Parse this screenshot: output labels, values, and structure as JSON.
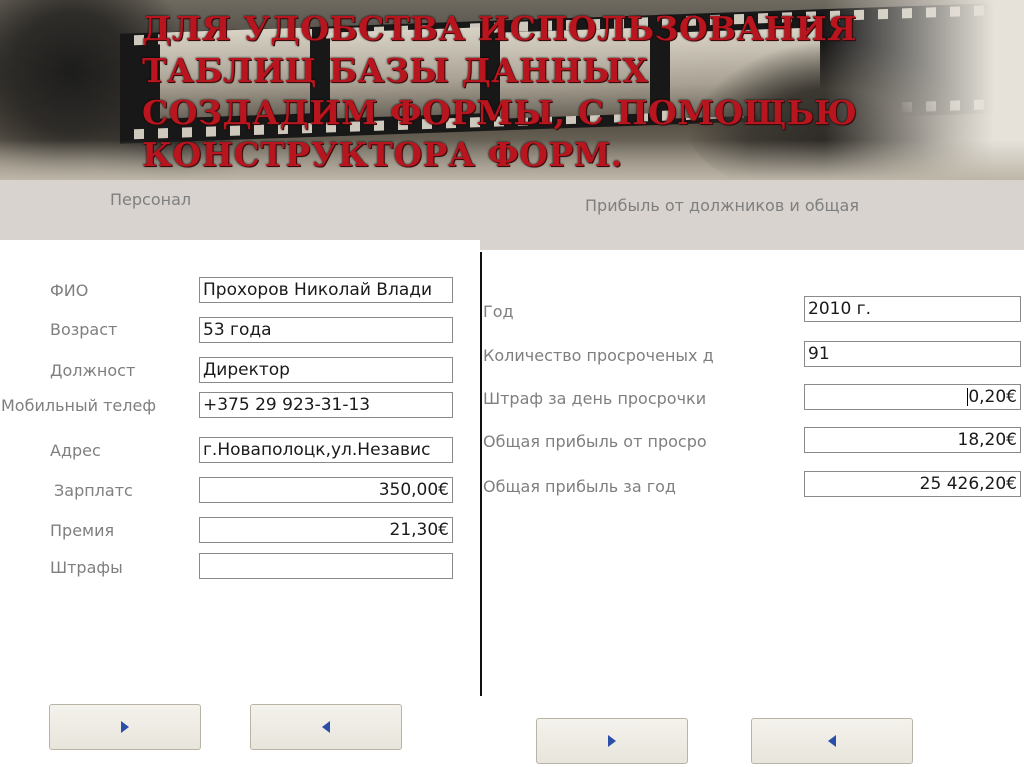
{
  "slide": {
    "title": "Для удобства использования таблиц базы данных создадим формы, с помощью конструктора форм."
  },
  "personnel_form": {
    "title": "Персонал",
    "fields": [
      {
        "label": "ФИО",
        "value": "Прохоров Николай Влади"
      },
      {
        "label": "Возраст",
        "value": "53 года"
      },
      {
        "label": "Должност",
        "value": "Директор"
      },
      {
        "label": "Мобильный телеф",
        "value": "+375 29 923-31-13"
      },
      {
        "label": "Адрес",
        "value": "г.Новаполоцк,ул.Независ"
      },
      {
        "label": "Зарплатс",
        "value": "350,00€"
      },
      {
        "label": "Премия",
        "value": "21,30€"
      },
      {
        "label": "Штрафы",
        "value": ""
      }
    ],
    "nav": {
      "next_icon": "arrow-right-icon",
      "prev_icon": "arrow-left-icon"
    }
  },
  "profit_form": {
    "title": "Прибыль от должников и общая",
    "fields": [
      {
        "label": "Год",
        "value": "2010 г."
      },
      {
        "label": "Количество просроченых д",
        "value": "91"
      },
      {
        "label": "Штраф за день просрочки",
        "value": "0,20€"
      },
      {
        "label": "Общая прибыль от просро",
        "value": "18,20€"
      },
      {
        "label": "Общая прибыль за год",
        "value": "25 426,20€"
      }
    ],
    "nav": {
      "next_icon": "arrow-right-icon",
      "prev_icon": "arrow-left-icon"
    }
  },
  "colors": {
    "title_red": "#b8151f",
    "header_gray": "#d8d3ce",
    "label_gray": "#7f7f7f",
    "arrow_blue": "#2b4fa8"
  }
}
